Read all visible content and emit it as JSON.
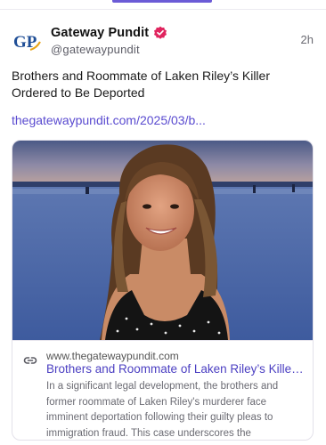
{
  "post": {
    "author": {
      "display_name": "Gateway Pundit",
      "handle": "@gatewaypundit",
      "avatar_text": "GP",
      "verified_color": "#e0245e"
    },
    "time": "2h",
    "text": "Brothers and Roommate of Laken Riley’s Killer Ordered to Be Deported",
    "link": "thegatewaypundit.com/2025/03/b..."
  },
  "card": {
    "domain": "www.thegatewaypundit.com",
    "title": "Brothers and Roommate of Laken Riley’s Killer Ordered to Be Deported",
    "description": "In a significant legal development, the brothers and former roommate of Laken Riley's murderer face imminent deportation following their guilty pleas to immigration fraud. This case underscores the implications of immigration policy.",
    "image_alt": "Photo of a smiling young woman on a beach at dusk"
  },
  "colors": {
    "accent": "#6b5bd6",
    "link": "#5a4bd0",
    "card_title": "#4b3fc2"
  }
}
